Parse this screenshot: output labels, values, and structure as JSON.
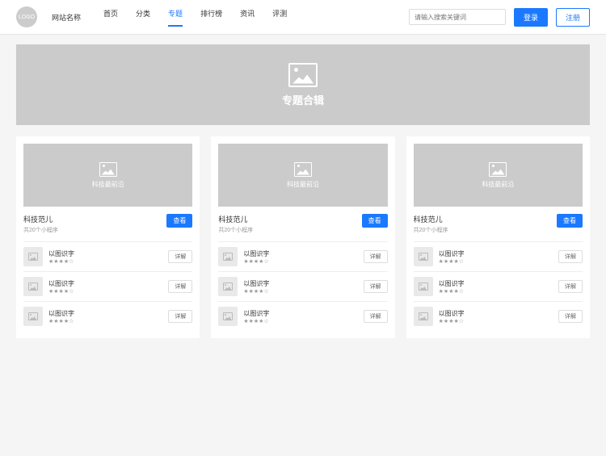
{
  "header": {
    "logo_text": "LOGO",
    "site_name": "网站名称",
    "nav": [
      {
        "label": "首页",
        "active": false
      },
      {
        "label": "分类",
        "active": false
      },
      {
        "label": "专题",
        "active": true
      },
      {
        "label": "排行榜",
        "active": false
      },
      {
        "label": "资讯",
        "active": false
      },
      {
        "label": "评测",
        "active": false
      }
    ],
    "search_placeholder": "请输入搜索关键词",
    "login_label": "登录",
    "register_label": "注册"
  },
  "hero": {
    "title": "专题合辑"
  },
  "card_img_title": "科技最前沿",
  "cards": [
    {
      "title": "科技范儿",
      "subtitle": "共20个小程序",
      "view_label": "查看",
      "items": [
        {
          "title": "以图识字",
          "rating": "★★★★☆",
          "btn": "详解"
        },
        {
          "title": "以图识字",
          "rating": "★★★★☆",
          "btn": "详解"
        },
        {
          "title": "以图识字",
          "rating": "★★★★☆",
          "btn": "详解"
        }
      ]
    },
    {
      "title": "科技范儿",
      "subtitle": "共20个小程序",
      "view_label": "查看",
      "items": [
        {
          "title": "以图识字",
          "rating": "★★★★☆",
          "btn": "详解"
        },
        {
          "title": "以图识字",
          "rating": "★★★★☆",
          "btn": "详解"
        },
        {
          "title": "以图识字",
          "rating": "★★★★☆",
          "btn": "详解"
        }
      ]
    },
    {
      "title": "科技范儿",
      "subtitle": "共20个小程序",
      "view_label": "查看",
      "items": [
        {
          "title": "以图识字",
          "rating": "★★★★☆",
          "btn": "详解"
        },
        {
          "title": "以图识字",
          "rating": "★★★★☆",
          "btn": "详解"
        },
        {
          "title": "以图识字",
          "rating": "★★★★☆",
          "btn": "详解"
        }
      ]
    }
  ]
}
